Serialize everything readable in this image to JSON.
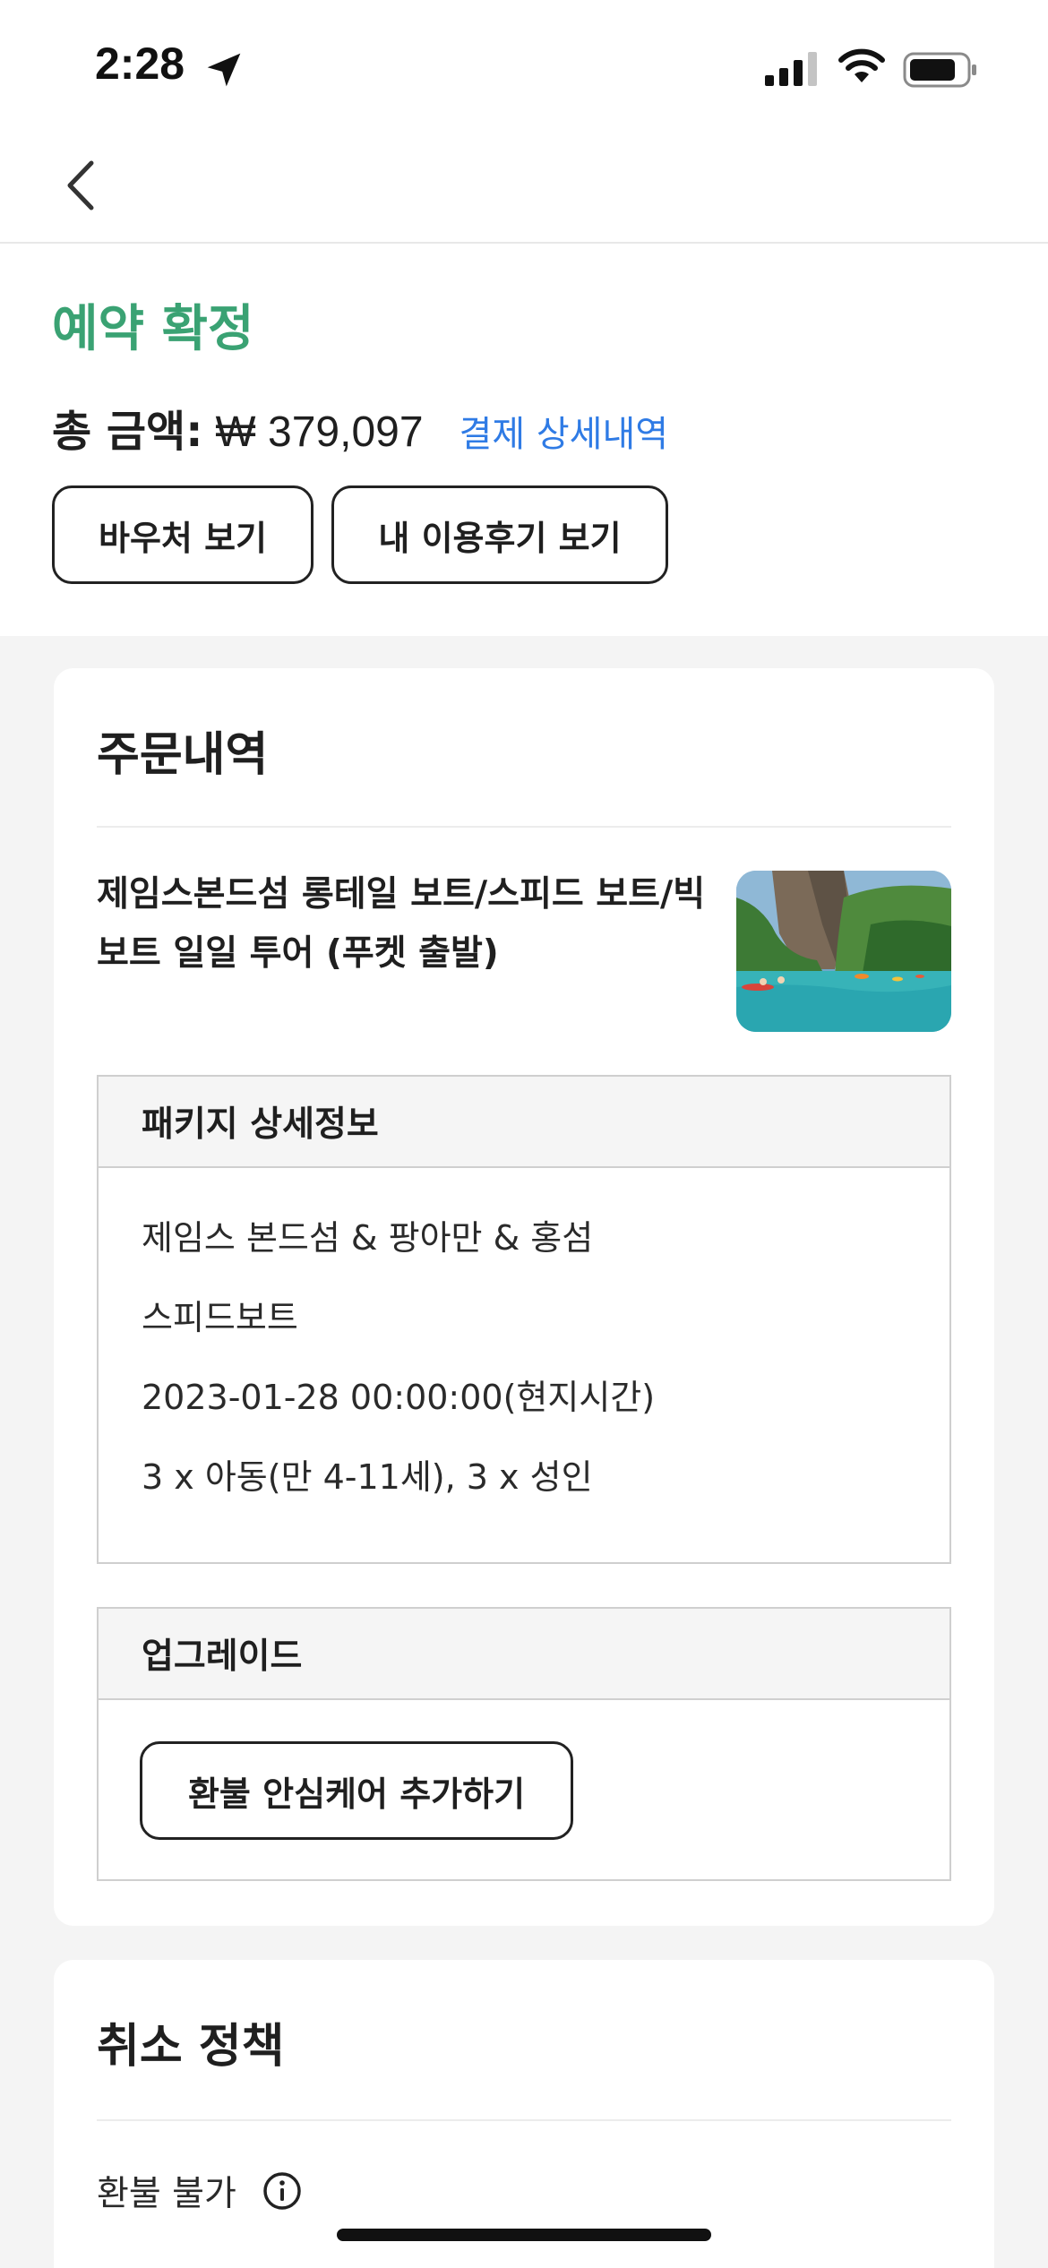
{
  "status_bar": {
    "time": "2:28"
  },
  "header": {
    "back_icon": "chevron-left-icon"
  },
  "booking": {
    "status": "예약 확정",
    "total_label": "총 금액:",
    "total_amount": "₩ 379,097",
    "payment_detail_link": "결제 상세내역",
    "voucher_button": "바우처 보기",
    "review_button": "내 이용후기 보기",
    "status_color": "#3aa273",
    "link_color": "#2f7be5"
  },
  "order": {
    "title": "주문내역",
    "product_name": "제임스본드섬 롱테일 보트/스피드 보트/빅보트 일일 투어 (푸켓 출발)",
    "package": {
      "header": "패키지 상세정보",
      "lines": [
        "제임스 본드섬 & 팡아만 & 홍섬",
        "스피드보트",
        "2023-01-28 00:00:00(현지시간)",
        "3 x 아동(만 4-11세), 3 x 성인"
      ]
    },
    "upgrade": {
      "header": "업그레이드",
      "button": "환불 안심케어 추가하기"
    }
  },
  "cancellation": {
    "title": "취소 정책",
    "policy": "환불 불가",
    "info_icon": "info-circle-icon"
  }
}
